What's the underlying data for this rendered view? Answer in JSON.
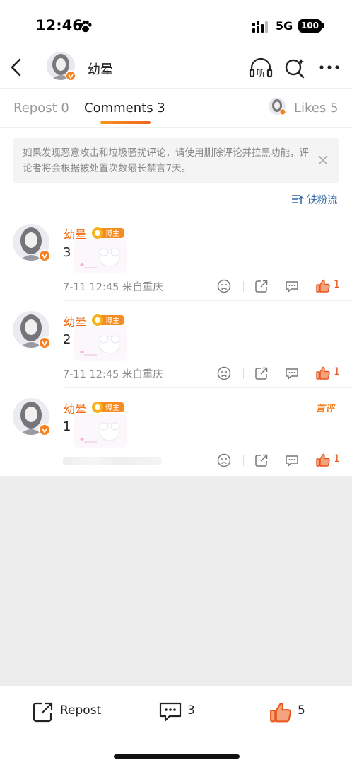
{
  "status_bar": {
    "time": "12:46",
    "network": "5G",
    "battery": "100"
  },
  "nav": {
    "title": "幼晕",
    "icons": [
      "back-icon",
      "listen-icon",
      "ai-search-icon",
      "more-icon"
    ],
    "listen_label": "听"
  },
  "tabs": {
    "repost": "Repost 0",
    "comments": "Comments 3",
    "likes": "Likes 5"
  },
  "notice": {
    "text": "如果发现恶意攻击和垃圾骚扰评论，请使用删除评论并拉黑功能，评论者将会根据被处置次数最长禁言7天。"
  },
  "sort": {
    "label": "铁粉流"
  },
  "comments": [
    {
      "name": "幼晕",
      "badge": "博主",
      "text": "3",
      "meta": "7-11 12:45  来自重庆",
      "likes": "1",
      "first": ""
    },
    {
      "name": "幼晕",
      "badge": "博主",
      "text": "2",
      "meta": "7-11 12:45  来自重庆",
      "likes": "1",
      "first": ""
    },
    {
      "name": "幼晕",
      "badge": "博主",
      "text": "1",
      "meta": "",
      "likes": "1",
      "first": "首评"
    }
  ],
  "bottom_bar": {
    "repost": "Repost",
    "comments": "3",
    "likes": "5"
  },
  "colors": {
    "accent": "#f26a13",
    "link": "#3b6fa8",
    "muted": "#888888"
  }
}
